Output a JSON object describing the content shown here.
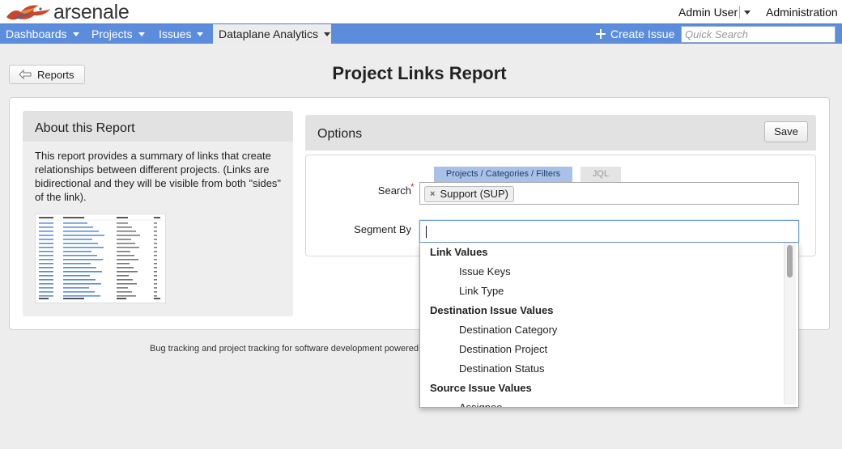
{
  "header": {
    "logo_text": "arsenale",
    "user_menu": "Admin User",
    "administration": "Administration"
  },
  "nav": {
    "items": [
      {
        "label": "Dashboards"
      },
      {
        "label": "Projects"
      },
      {
        "label": "Issues"
      },
      {
        "label": "Dataplane Analytics"
      }
    ],
    "create_issue": "Create Issue",
    "quick_search_placeholder": "Quick Search"
  },
  "page": {
    "back_label": "Reports",
    "title": "Project Links Report"
  },
  "about": {
    "title": "About this Report",
    "text": "This report provides a summary of links that create relationships between different projects. (Links are bidirectional and they will be visible from both \"sides\" of the link)."
  },
  "options": {
    "title": "Options",
    "save_label": "Save",
    "tabs": [
      {
        "label": "Projects / Categories / Filters",
        "active": true
      },
      {
        "label": "JQL",
        "active": false
      }
    ],
    "search_label": "Search",
    "required_mark": "*",
    "search_chip": "Support (SUP)",
    "chip_remove": "×",
    "segment_label": "Segment By",
    "segment_value": ""
  },
  "dropdown": {
    "entries": [
      {
        "label": "Link Values",
        "kind": "group"
      },
      {
        "label": "Issue Keys",
        "kind": "option"
      },
      {
        "label": "Link Type",
        "kind": "option"
      },
      {
        "label": "Destination Issue Values",
        "kind": "group"
      },
      {
        "label": "Destination Category",
        "kind": "option"
      },
      {
        "label": "Destination Project",
        "kind": "option"
      },
      {
        "label": "Destination Status",
        "kind": "option"
      },
      {
        "label": "Source Issue Values",
        "kind": "group"
      },
      {
        "label": "Assignee",
        "kind": "option"
      }
    ]
  },
  "footer": {
    "text": "Bug tracking and project tracking for software development powered"
  },
  "colors": {
    "nav_bg": "#5b8ddc",
    "active_tab": "#a9c1e6",
    "page_bg": "#ededed"
  }
}
